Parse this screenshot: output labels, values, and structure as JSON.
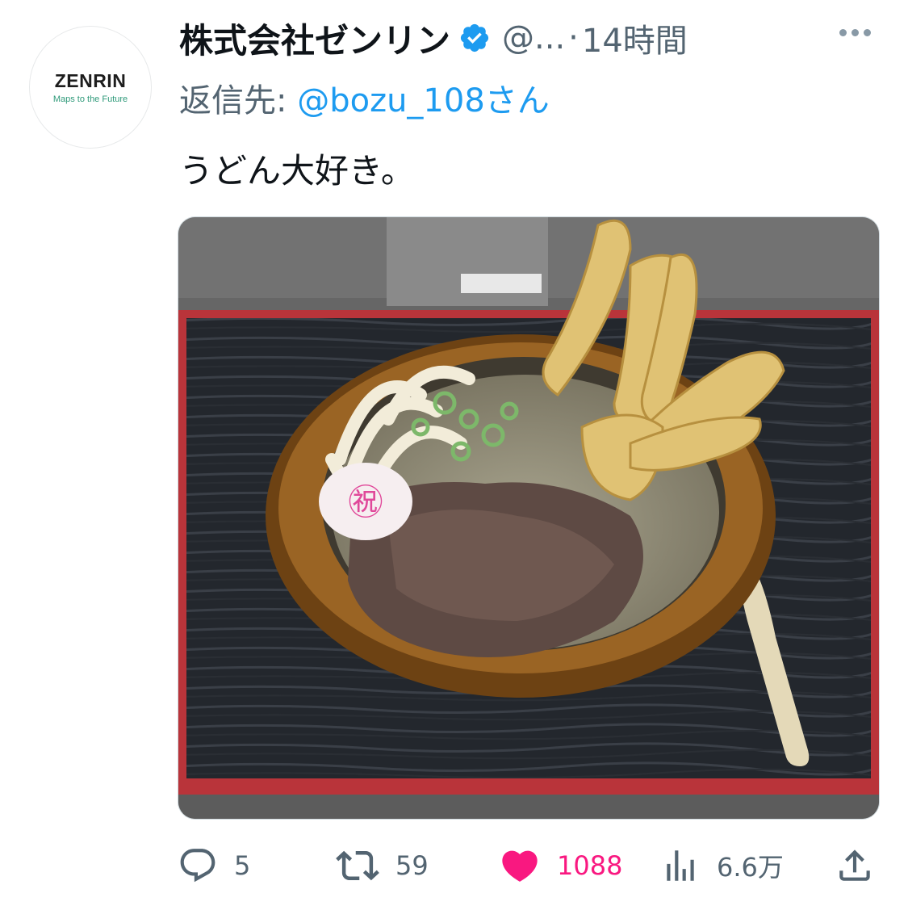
{
  "tweet": {
    "author_name": "株式会社ゼンリン",
    "handle": "@...",
    "separator": "·",
    "time": "14時間",
    "reply_prefix": "返信先:",
    "reply_to": "@bozu_108さん",
    "text": "うどん大好き。",
    "avatar": {
      "logo_main": "ZENRIN",
      "logo_sub": "Maps to the Future"
    },
    "media": {
      "alt": "udon-photo",
      "kamaboko_text": "㊗"
    }
  },
  "actions": {
    "replies": "5",
    "retweets": "59",
    "likes": "1088",
    "views": "6.6万"
  },
  "icons": {
    "verified": "verified-badge-icon",
    "more": "more-icon",
    "reply": "reply-icon",
    "retweet": "retweet-icon",
    "like": "heart-icon",
    "views": "views-icon",
    "share": "share-icon"
  },
  "colors": {
    "accent": "#1d9bf0",
    "like": "#f91880",
    "muted": "#536471"
  }
}
